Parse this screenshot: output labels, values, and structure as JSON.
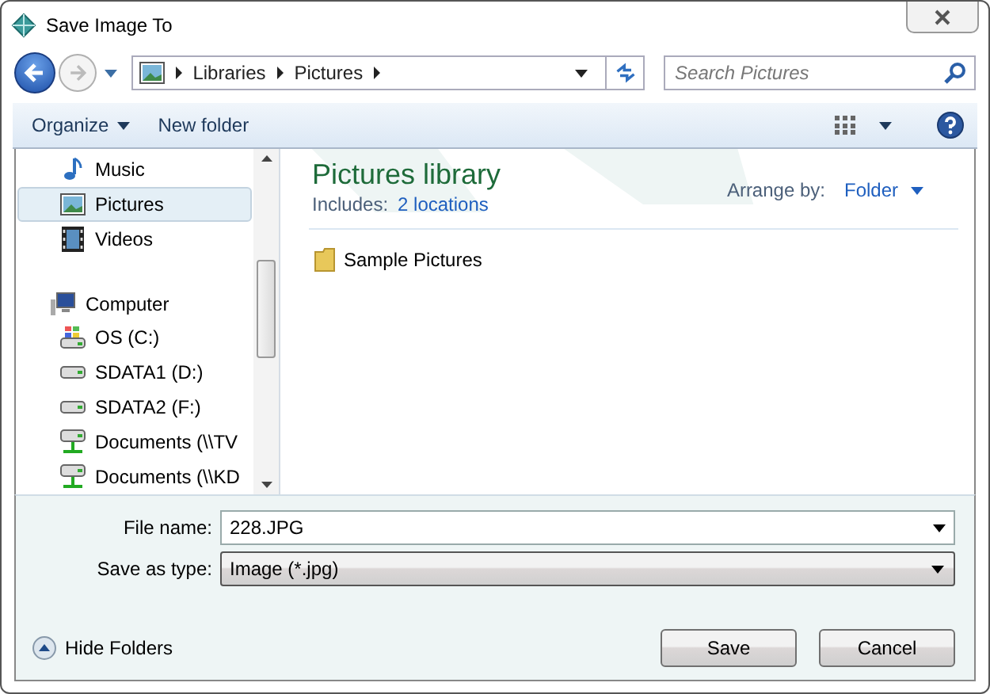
{
  "window": {
    "title": "Save Image To"
  },
  "navigation": {
    "back_enabled": true,
    "forward_enabled": false,
    "breadcrumb": [
      "Libraries",
      "Pictures"
    ],
    "search": {
      "placeholder": "Search Pictures"
    }
  },
  "toolbar": {
    "organize": "Organize",
    "new_folder": "New folder"
  },
  "sidebar": {
    "items": [
      {
        "label": "Music",
        "kind": "music",
        "selected": false
      },
      {
        "label": "Pictures",
        "kind": "pictures",
        "selected": true
      },
      {
        "label": "Videos",
        "kind": "videos",
        "selected": false
      },
      {
        "label": "Computer",
        "kind": "computer",
        "selected": false,
        "children": [
          {
            "label": "OS (C:)",
            "kind": "os-drive",
            "selected": false
          },
          {
            "label": "SDATA1 (D:)",
            "kind": "drive",
            "selected": false
          },
          {
            "label": "SDATA2 (F:)",
            "kind": "drive",
            "selected": false
          },
          {
            "label": "Documents (\\\\TV",
            "kind": "network-drive",
            "selected": false
          },
          {
            "label": "Documents (\\\\KD",
            "kind": "network-drive",
            "selected": false
          }
        ]
      }
    ]
  },
  "library": {
    "title": "Pictures library",
    "includes_label": "Includes:",
    "includes_link": "2 locations",
    "arrange_label": "Arrange by:",
    "arrange_value": "Folder"
  },
  "files": [
    {
      "name": "Sample Pictures"
    }
  ],
  "form": {
    "file_name_label": "File name:",
    "file_name": "228.JPG",
    "type_label": "Save as type:",
    "type": "Image (*.jpg)"
  },
  "footer": {
    "hide_folders": "Hide Folders",
    "buttons": [
      "Save",
      "Cancel"
    ]
  }
}
